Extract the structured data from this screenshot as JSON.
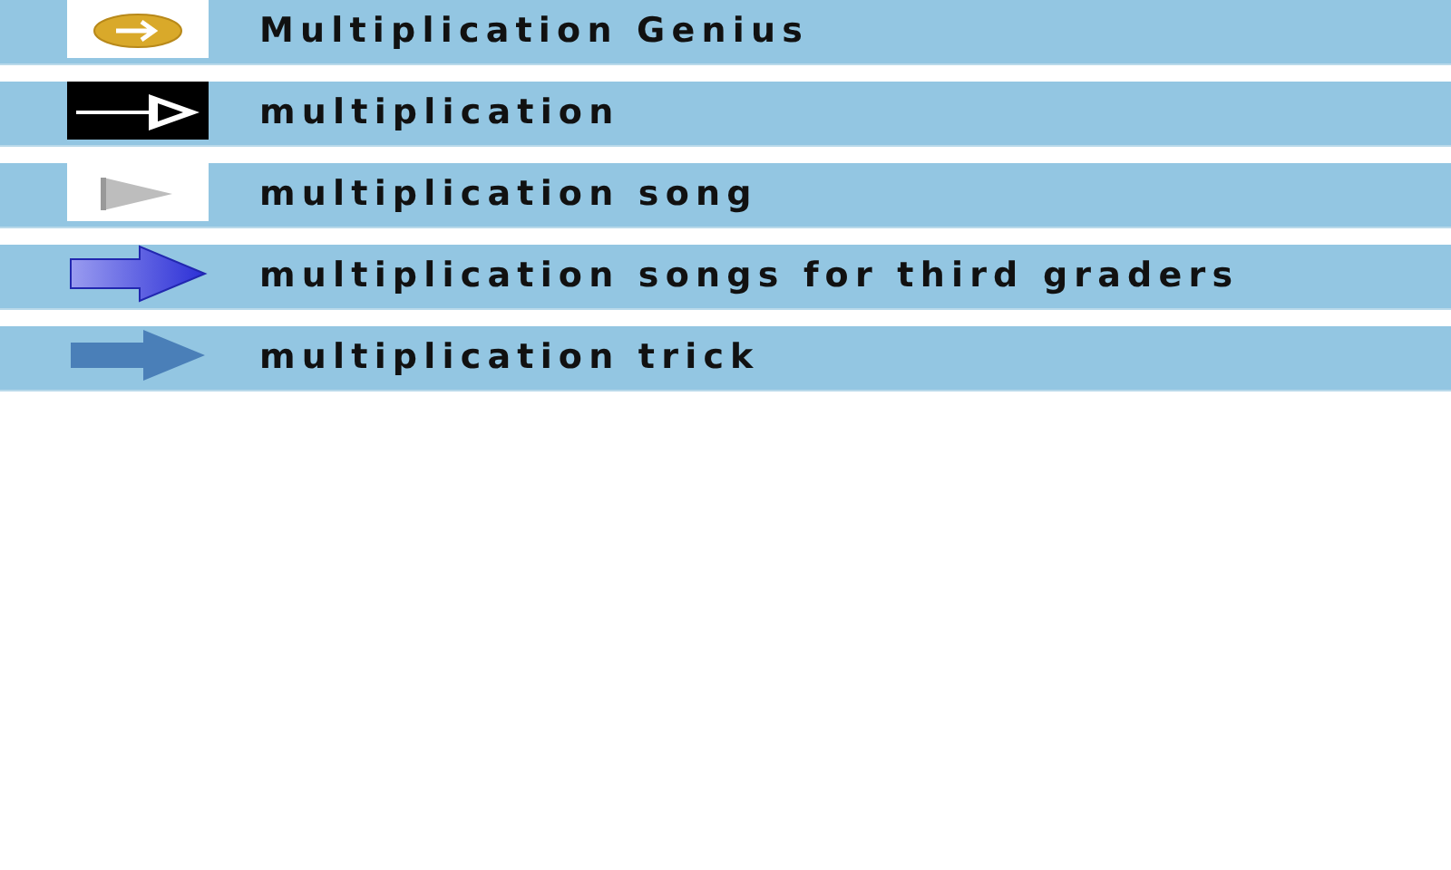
{
  "items": [
    {
      "kind": "gold-oval",
      "label": "Multiplication Genius"
    },
    {
      "kind": "black-arrow",
      "label": "multiplication"
    },
    {
      "kind": "gray-arrow",
      "label": "multiplication song"
    },
    {
      "kind": "blue-arrow",
      "label": "multiplication songs for third graders"
    },
    {
      "kind": "steel-arrow",
      "label": "multiplication trick"
    }
  ]
}
